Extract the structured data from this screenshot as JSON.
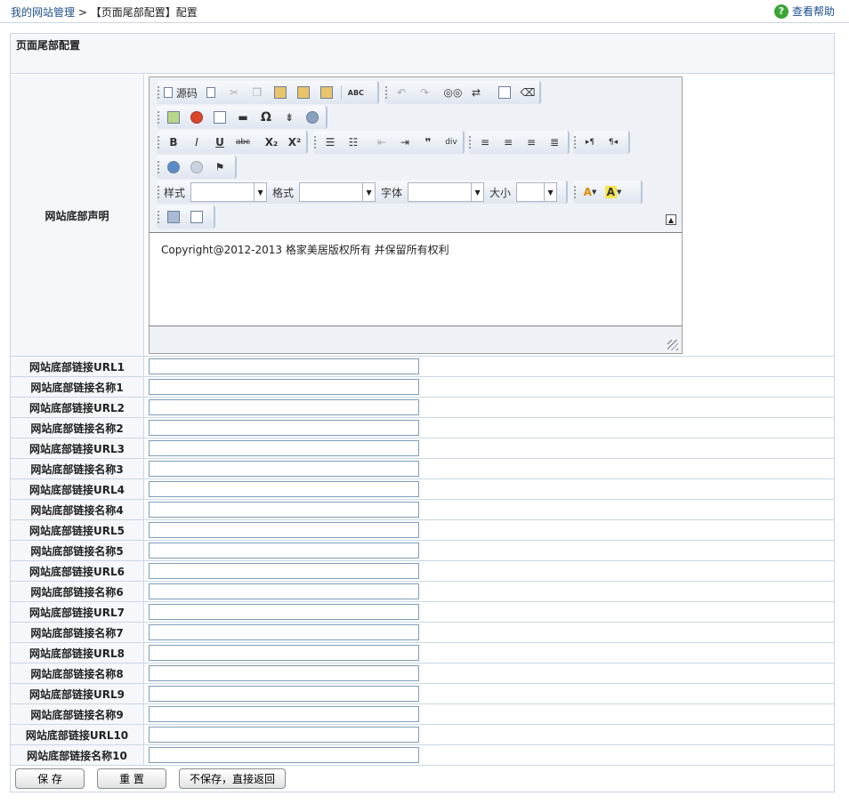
{
  "breadcrumb": {
    "root": "我的网站管理",
    "sep": " > ",
    "current": "【页面尾部配置】配置"
  },
  "help": {
    "icon": "help-icon",
    "label": "查看帮助"
  },
  "section": {
    "title": "页面尾部配置"
  },
  "editor": {
    "field_label": "网站底部声明",
    "source_label": "源码",
    "content": "Copyright@2012-2013 格家美居版权所有 并保留所有权利",
    "style_label": "样式",
    "format_label": "格式",
    "font_label": "字体",
    "size_label": "大小",
    "bold": "B",
    "italic": "I",
    "underline": "U",
    "strike": "abc",
    "sub": "X₂",
    "sup": "X²",
    "omega": "Ω",
    "quote": "❞",
    "ltr": "▸¶",
    "rtl": "¶◂",
    "text_color": "A",
    "bg_color": "A",
    "spell": "ABC"
  },
  "fields": [
    {
      "label": "网站底部链接URL1",
      "value": ""
    },
    {
      "label": "网站底部链接名称1",
      "value": ""
    },
    {
      "label": "网站底部链接URL2",
      "value": ""
    },
    {
      "label": "网站底部链接名称2",
      "value": ""
    },
    {
      "label": "网站底部链接URL3",
      "value": ""
    },
    {
      "label": "网站底部链接名称3",
      "value": ""
    },
    {
      "label": "网站底部链接URL4",
      "value": ""
    },
    {
      "label": "网站底部链接名称4",
      "value": ""
    },
    {
      "label": "网站底部链接URL5",
      "value": ""
    },
    {
      "label": "网站底部链接名称5",
      "value": ""
    },
    {
      "label": "网站底部链接URL6",
      "value": ""
    },
    {
      "label": "网站底部链接名称6",
      "value": ""
    },
    {
      "label": "网站底部链接URL7",
      "value": ""
    },
    {
      "label": "网站底部链接名称7",
      "value": ""
    },
    {
      "label": "网站底部链接URL8",
      "value": ""
    },
    {
      "label": "网站底部链接名称8",
      "value": ""
    },
    {
      "label": "网站底部链接URL9",
      "value": ""
    },
    {
      "label": "网站底部链接名称9",
      "value": ""
    },
    {
      "label": "网站底部链接URL10",
      "value": ""
    },
    {
      "label": "网站底部链接名称10",
      "value": ""
    }
  ],
  "actions": {
    "save": "保 存",
    "reset": "重 置",
    "back": "不保存，直接返回"
  }
}
